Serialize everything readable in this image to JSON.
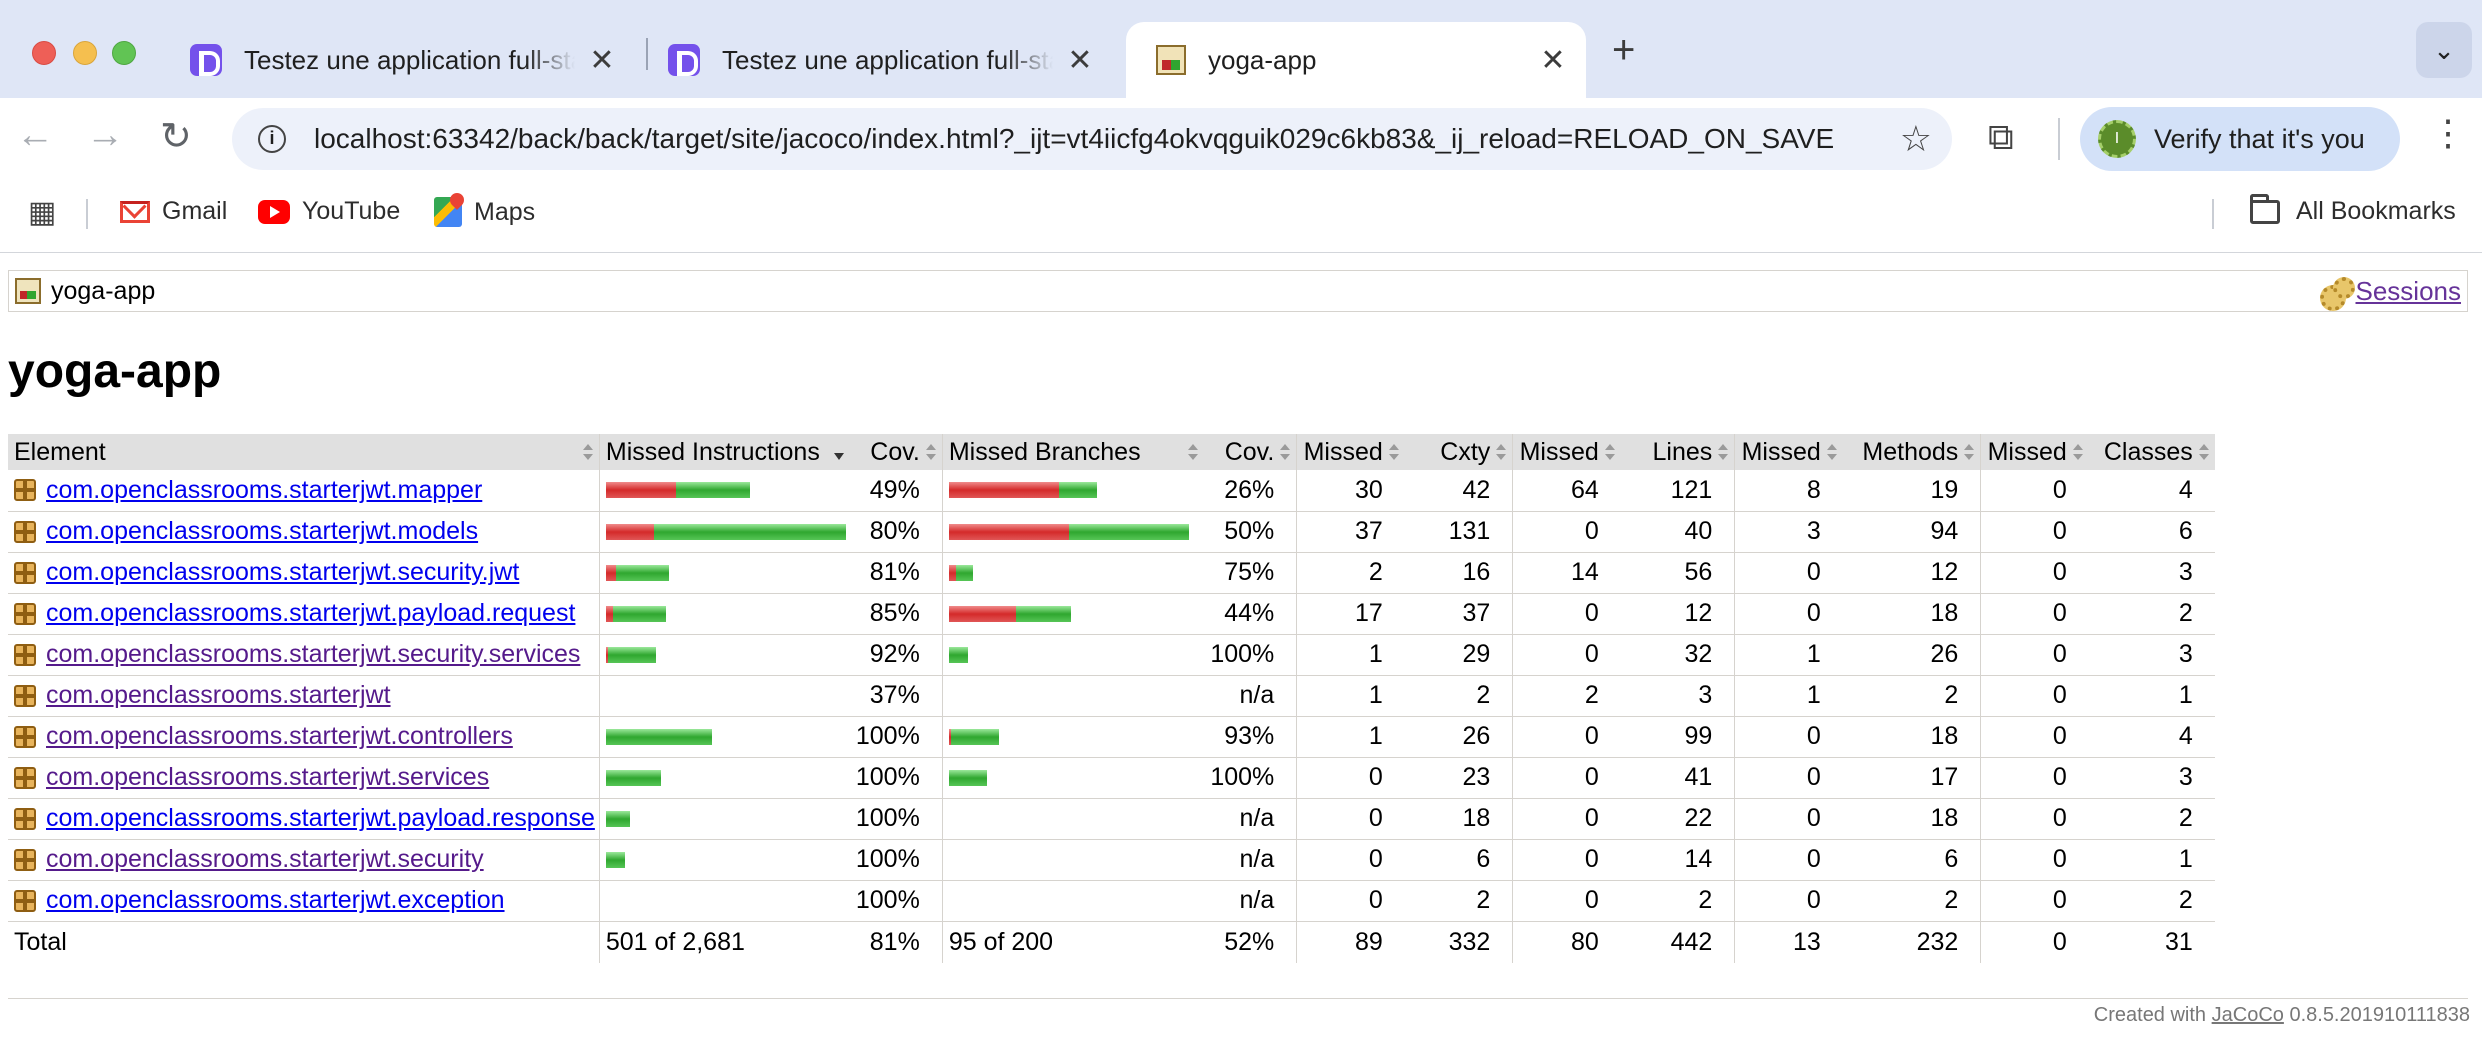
{
  "browser": {
    "tabs": [
      {
        "title": "Testez une application full-stack",
        "close": "✕"
      },
      {
        "title": "Testez une application full-stack",
        "close": "✕"
      },
      {
        "title": "yoga-app",
        "close": "✕"
      }
    ],
    "new_tab": "+",
    "tab_search": "⌄",
    "url": "localhost:63342/back/back/target/site/jacoco/index.html?_ijt=vt4iicfg4okvqguik029c6kb83&_ij_reload=RELOAD_ON_SAVE",
    "verify_label": "Verify that it's you",
    "bookmarks": [
      {
        "label": "Gmail",
        "icon": "gmail-icon"
      },
      {
        "label": "YouTube",
        "icon": "youtube-icon"
      },
      {
        "label": "Maps",
        "icon": "maps-icon"
      }
    ],
    "all_bookmarks": "All Bookmarks"
  },
  "page": {
    "breadcrumb": "yoga-app",
    "sessions_link": "Sessions",
    "title": "yoga-app",
    "columns": [
      "Element",
      "Missed Instructions",
      "Cov.",
      "Missed Branches",
      "Cov.",
      "Missed",
      "Cxty",
      "Missed",
      "Lines",
      "Missed",
      "Methods",
      "Missed",
      "Classes"
    ],
    "rows": [
      {
        "name": "com.openclassrooms.starterjwt.mapper",
        "visited": false,
        "instr_cov": "49%",
        "branch_cov": "26%",
        "instr_bar": [
          0.29,
          0.31
        ],
        "branch_bar": [
          0.46,
          0.16
        ],
        "missed_cxty": "30",
        "cxty": "42",
        "missed_lines": "64",
        "lines": "121",
        "missed_methods": "8",
        "methods": "19",
        "missed_classes": "0",
        "classes": "4"
      },
      {
        "name": "com.openclassrooms.starterjwt.models",
        "visited": false,
        "instr_cov": "80%",
        "branch_cov": "50%",
        "instr_bar": [
          0.2,
          0.8
        ],
        "branch_bar": [
          0.5,
          0.5
        ],
        "missed_cxty": "37",
        "cxty": "131",
        "missed_lines": "0",
        "lines": "40",
        "missed_methods": "3",
        "methods": "94",
        "missed_classes": "0",
        "classes": "6"
      },
      {
        "name": "com.openclassrooms.starterjwt.security.jwt",
        "visited": false,
        "instr_cov": "81%",
        "branch_cov": "75%",
        "instr_bar": [
          0.04,
          0.22
        ],
        "branch_bar": [
          0.03,
          0.07
        ],
        "missed_cxty": "2",
        "cxty": "16",
        "missed_lines": "14",
        "lines": "56",
        "missed_methods": "0",
        "methods": "12",
        "missed_classes": "0",
        "classes": "3"
      },
      {
        "name": "com.openclassrooms.starterjwt.payload.request",
        "visited": false,
        "instr_cov": "85%",
        "branch_cov": "44%",
        "instr_bar": [
          0.03,
          0.22
        ],
        "branch_bar": [
          0.28,
          0.23
        ],
        "missed_cxty": "17",
        "cxty": "37",
        "missed_lines": "0",
        "lines": "12",
        "missed_methods": "0",
        "methods": "18",
        "missed_classes": "0",
        "classes": "2"
      },
      {
        "name": "com.openclassrooms.starterjwt.security.services",
        "visited": true,
        "instr_cov": "92%",
        "branch_cov": "100%",
        "instr_bar": [
          0.01,
          0.2
        ],
        "branch_bar": [
          0.0,
          0.08
        ],
        "missed_cxty": "1",
        "cxty": "29",
        "missed_lines": "0",
        "lines": "32",
        "missed_methods": "1",
        "methods": "26",
        "missed_classes": "0",
        "classes": "3"
      },
      {
        "name": "com.openclassrooms.starterjwt",
        "visited": true,
        "instr_cov": "37%",
        "branch_cov": "n/a",
        "instr_bar": [
          0,
          0
        ],
        "branch_bar": [
          0,
          0
        ],
        "missed_cxty": "1",
        "cxty": "2",
        "missed_lines": "2",
        "lines": "3",
        "missed_methods": "1",
        "methods": "2",
        "missed_classes": "0",
        "classes": "1"
      },
      {
        "name": "com.openclassrooms.starterjwt.controllers",
        "visited": true,
        "instr_cov": "100%",
        "branch_cov": "93%",
        "instr_bar": [
          0,
          0.44
        ],
        "branch_bar": [
          0.01,
          0.2
        ],
        "missed_cxty": "1",
        "cxty": "26",
        "missed_lines": "0",
        "lines": "99",
        "missed_methods": "0",
        "methods": "18",
        "missed_classes": "0",
        "classes": "4"
      },
      {
        "name": "com.openclassrooms.starterjwt.services",
        "visited": true,
        "instr_cov": "100%",
        "branch_cov": "100%",
        "instr_bar": [
          0,
          0.23
        ],
        "branch_bar": [
          0,
          0.16
        ],
        "missed_cxty": "0",
        "cxty": "23",
        "missed_lines": "0",
        "lines": "41",
        "missed_methods": "0",
        "methods": "17",
        "missed_classes": "0",
        "classes": "3"
      },
      {
        "name": "com.openclassrooms.starterjwt.payload.response",
        "visited": false,
        "instr_cov": "100%",
        "branch_cov": "n/a",
        "instr_bar": [
          0,
          0.1
        ],
        "branch_bar": [
          0,
          0
        ],
        "missed_cxty": "0",
        "cxty": "18",
        "missed_lines": "0",
        "lines": "22",
        "missed_methods": "0",
        "methods": "18",
        "missed_classes": "0",
        "classes": "2"
      },
      {
        "name": "com.openclassrooms.starterjwt.security",
        "visited": true,
        "instr_cov": "100%",
        "branch_cov": "n/a",
        "instr_bar": [
          0,
          0.08
        ],
        "branch_bar": [
          0,
          0
        ],
        "missed_cxty": "0",
        "cxty": "6",
        "missed_lines": "0",
        "lines": "14",
        "missed_methods": "0",
        "methods": "6",
        "missed_classes": "0",
        "classes": "1"
      },
      {
        "name": "com.openclassrooms.starterjwt.exception",
        "visited": false,
        "instr_cov": "100%",
        "branch_cov": "n/a",
        "instr_bar": [
          0,
          0
        ],
        "branch_bar": [
          0,
          0
        ],
        "missed_cxty": "0",
        "cxty": "2",
        "missed_lines": "0",
        "lines": "2",
        "missed_methods": "0",
        "methods": "2",
        "missed_classes": "0",
        "classes": "2"
      }
    ],
    "total": {
      "label": "Total",
      "missed_instructions": "501 of 2,681",
      "instr_cov": "81%",
      "missed_branches": "95 of 200",
      "branch_cov": "52%",
      "missed_cxty": "89",
      "cxty": "332",
      "missed_lines": "80",
      "lines": "442",
      "missed_methods": "13",
      "methods": "232",
      "missed_classes": "0",
      "classes": "31"
    },
    "footer": {
      "prefix": "Created with",
      "link": "JaCoCo",
      "version": "0.8.5.201910111838"
    }
  },
  "colors": {
    "bar_red": "#d42a2a",
    "bar_green": "#2fa72f",
    "header_bg": "#e0e0e0",
    "link": "#0000ee",
    "visited_link": "#551a8b"
  }
}
